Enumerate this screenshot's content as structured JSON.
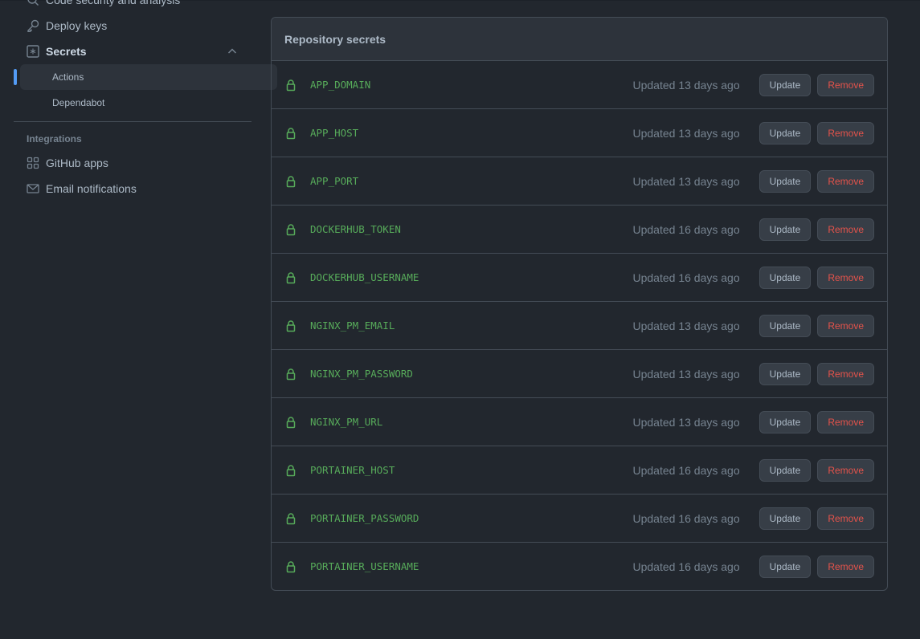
{
  "sidebar": {
    "items": [
      {
        "label": "Code security and analysis",
        "icon": "shield-search-icon"
      },
      {
        "label": "Deploy keys",
        "icon": "key-icon"
      },
      {
        "label": "Secrets",
        "icon": "asterisk-icon"
      }
    ],
    "sub_items": [
      {
        "label": "Actions",
        "active": true
      },
      {
        "label": "Dependabot",
        "active": false
      }
    ],
    "integrations_heading": "Integrations",
    "integrations": [
      {
        "label": "GitHub apps",
        "icon": "apps-icon"
      },
      {
        "label": "Email notifications",
        "icon": "mail-icon"
      }
    ]
  },
  "secrets": {
    "title": "Repository secrets",
    "update_label": "Update",
    "remove_label": "Remove",
    "rows": [
      {
        "name": "APP_DOMAIN",
        "updated": "Updated 13 days ago"
      },
      {
        "name": "APP_HOST",
        "updated": "Updated 13 days ago"
      },
      {
        "name": "APP_PORT",
        "updated": "Updated 13 days ago"
      },
      {
        "name": "DOCKERHUB_TOKEN",
        "updated": "Updated 16 days ago"
      },
      {
        "name": "DOCKERHUB_USERNAME",
        "updated": "Updated 16 days ago"
      },
      {
        "name": "NGINX_PM_EMAIL",
        "updated": "Updated 13 days ago"
      },
      {
        "name": "NGINX_PM_PASSWORD",
        "updated": "Updated 13 days ago"
      },
      {
        "name": "NGINX_PM_URL",
        "updated": "Updated 13 days ago"
      },
      {
        "name": "PORTAINER_HOST",
        "updated": "Updated 16 days ago"
      },
      {
        "name": "PORTAINER_PASSWORD",
        "updated": "Updated 16 days ago"
      },
      {
        "name": "PORTAINER_USERNAME",
        "updated": "Updated 16 days ago"
      }
    ]
  },
  "colors": {
    "background": "#22272e",
    "accent": "#539bf5",
    "secret_name": "#57ab5a",
    "danger": "#e5534b"
  }
}
